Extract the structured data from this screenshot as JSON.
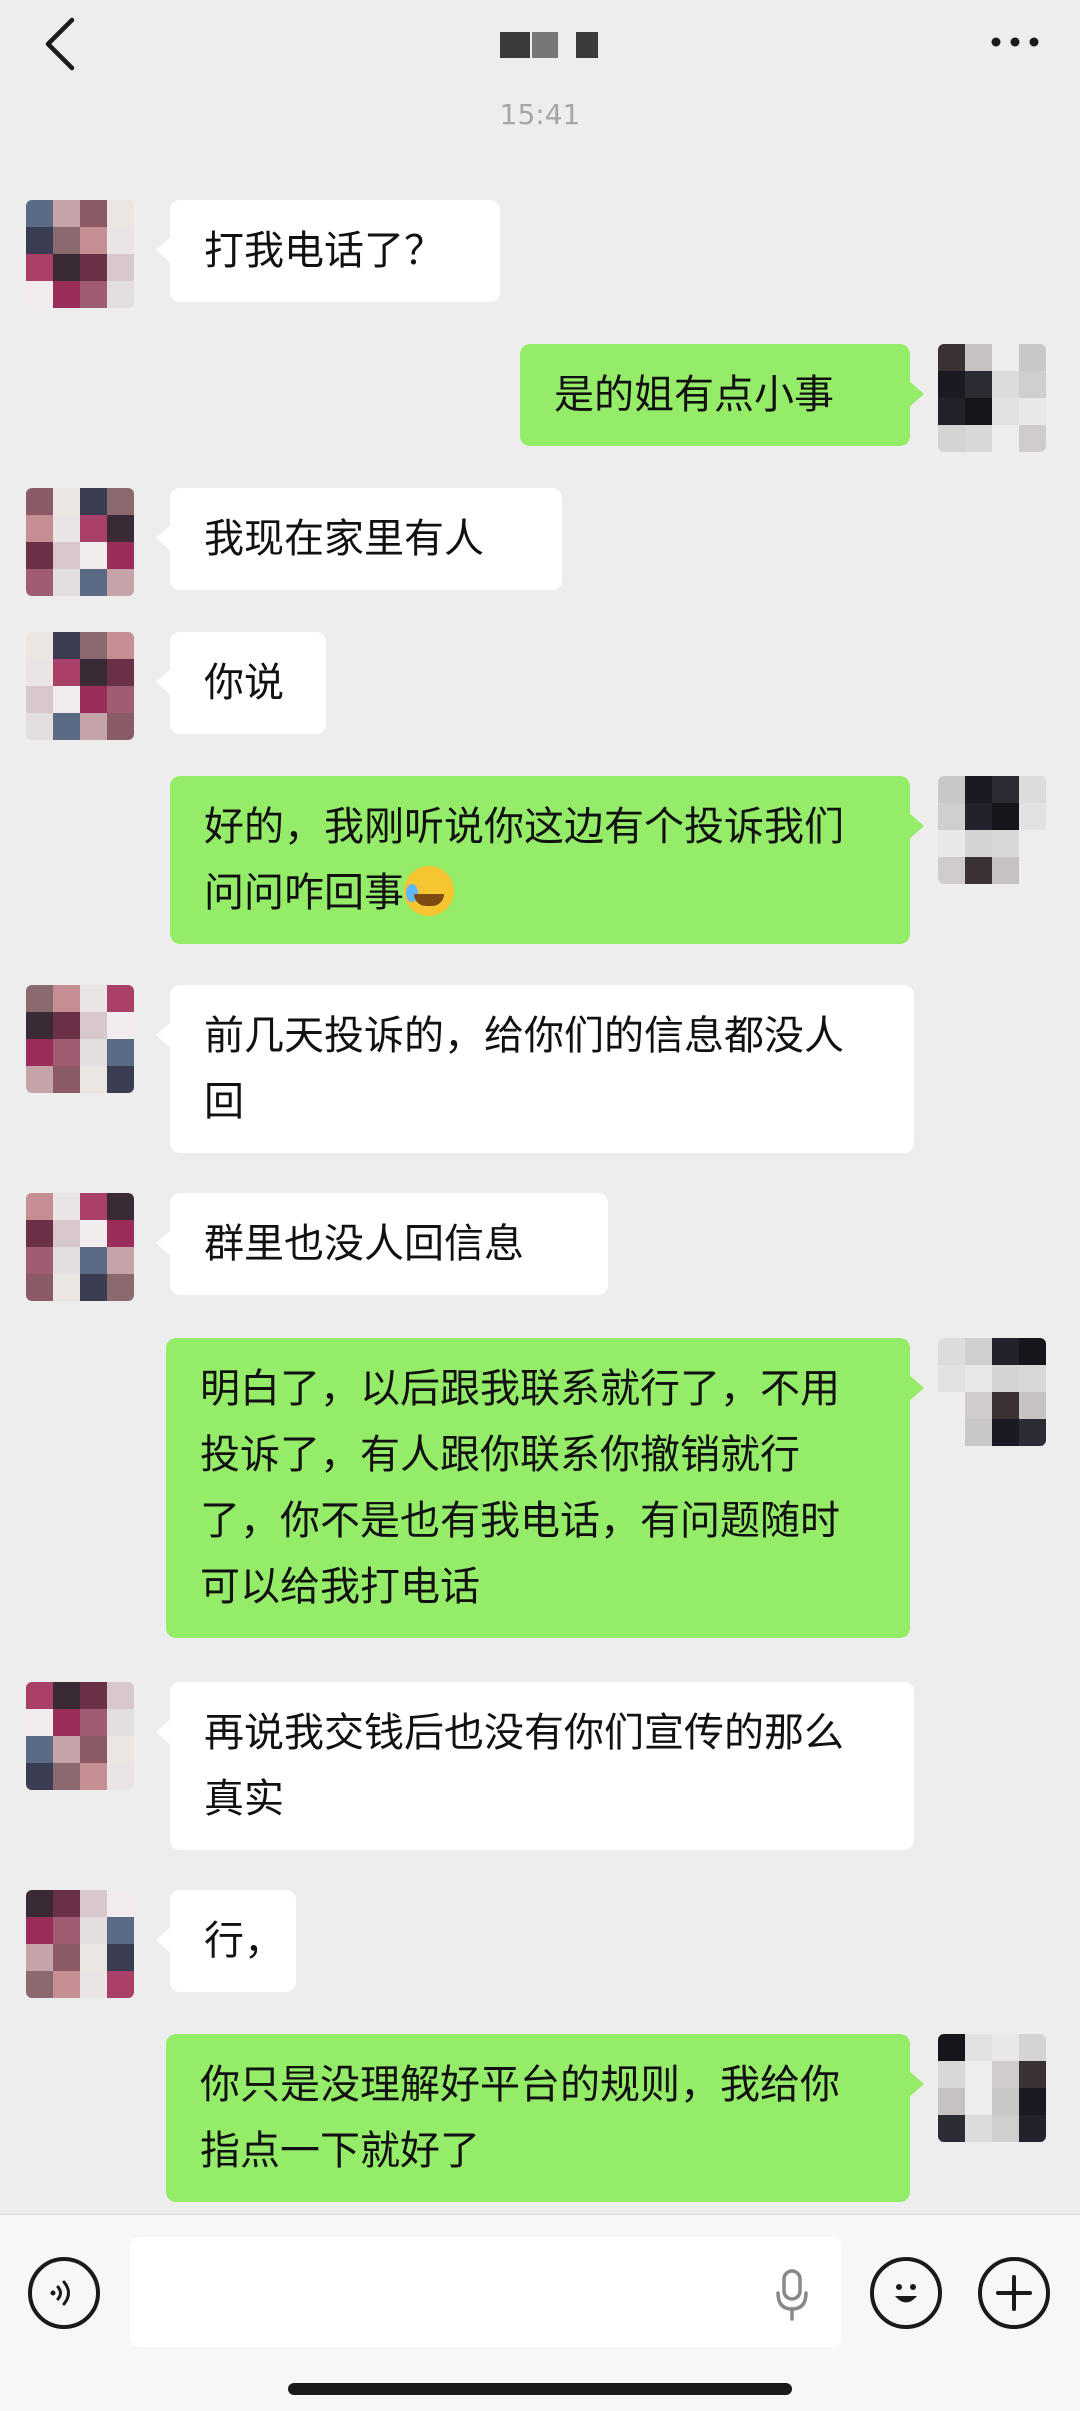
{
  "header": {
    "title": "",
    "time": "15:41"
  },
  "messages": [
    {
      "side": "left",
      "text": "打我电话了？"
    },
    {
      "side": "right",
      "text": "是的姐有点小事"
    },
    {
      "side": "left",
      "text": "我现在家里有人"
    },
    {
      "side": "left",
      "text": "你说"
    },
    {
      "side": "right",
      "text": "好的，我刚听说你这边有个投诉我们问问咋回事",
      "emoji": "cry-laugh-emoji"
    },
    {
      "side": "left",
      "text": "前几天投诉的，给你们的信息都没人回"
    },
    {
      "side": "left",
      "text": "群里也没人回信息"
    },
    {
      "side": "right",
      "text": "明白了，以后跟我联系就行了，不用投诉了，有人跟你联系你撤销就行了，你不是也有我电话，有问题随时可以给我打电话"
    },
    {
      "side": "left",
      "text": "再说我交钱后也没有你们宣传的那么真实"
    },
    {
      "side": "left",
      "text": "行，"
    },
    {
      "side": "right",
      "text": "你只是没理解好平台的规则，我给你指点一下就好了"
    }
  ],
  "input": {
    "placeholder": "",
    "value": ""
  },
  "icons": {
    "back": "chevron-left-icon",
    "more": "more-dots-icon",
    "voice": "voice-icon",
    "mic": "microphone-icon",
    "emoji": "emoji-icon",
    "plus": "plus-icon"
  },
  "colors": {
    "background": "#ededed",
    "bubble_left": "#ffffff",
    "bubble_right": "#95ec69"
  }
}
